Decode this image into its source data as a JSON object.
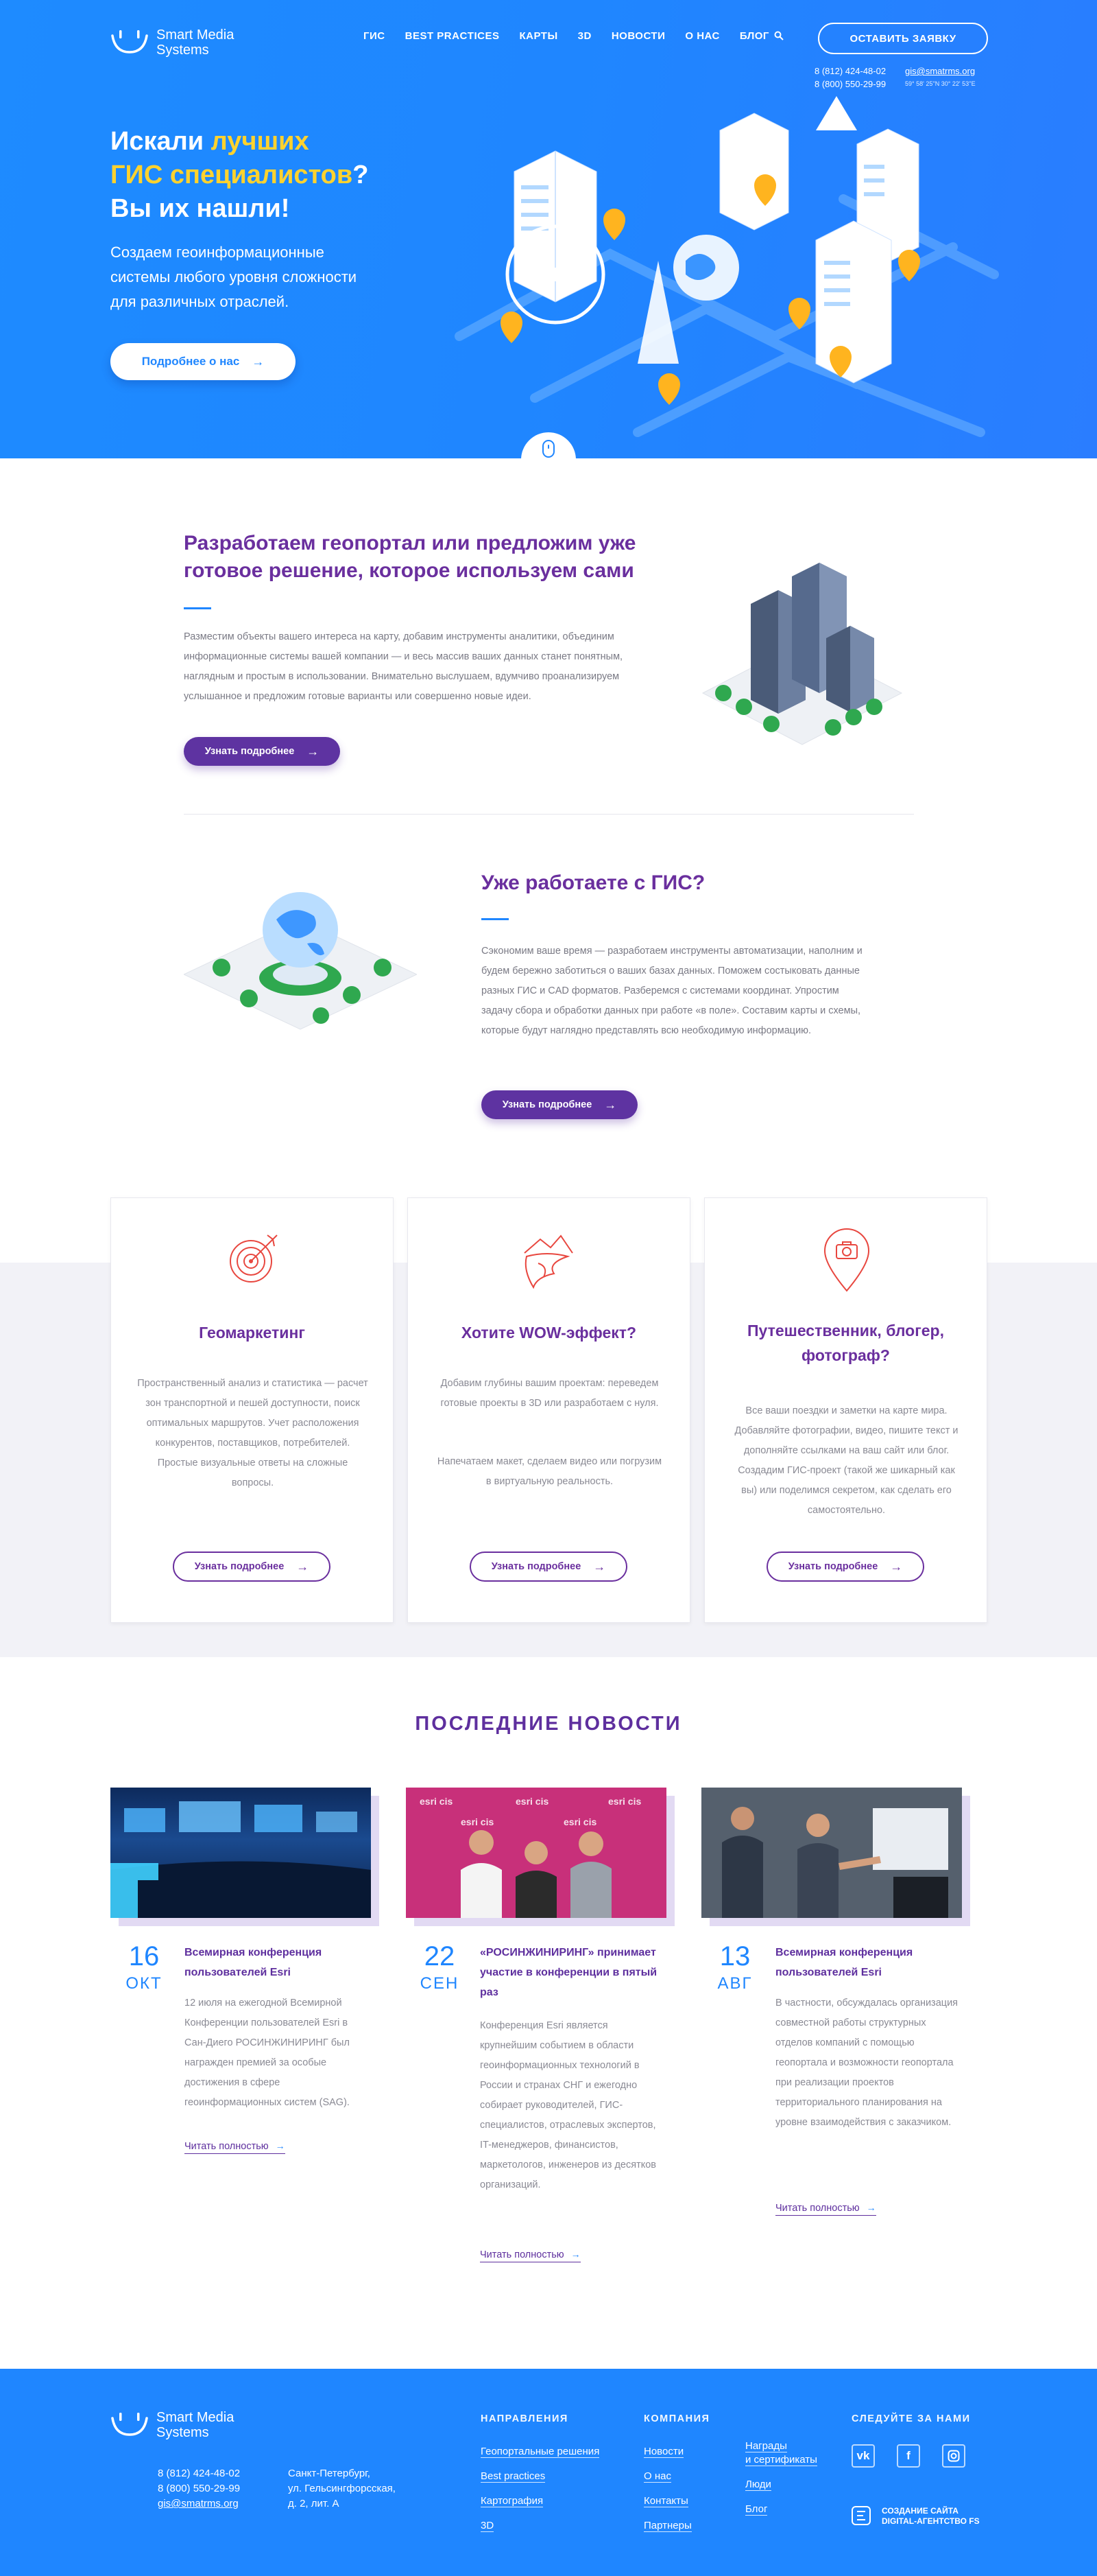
{
  "brand": {
    "line1": "Smart Media",
    "line2": "Systems"
  },
  "nav": {
    "items": [
      "ГИС",
      "BEST PRACTICES",
      "КАРТЫ",
      "3D",
      "НОВОСТИ",
      "О НАС",
      "БЛОГ"
    ]
  },
  "header": {
    "cta_label": "ОСТАВИТЬ ЗАЯВКУ",
    "phone1": "8 (812) 424-48-02",
    "phone2": "8 (800) 550-29-99",
    "email": "gis@smatrms.org",
    "coords": "59° 58' 25''N  30° 22' 53''E"
  },
  "hero": {
    "title_a": "Искали ",
    "title_b": "лучших",
    "title_c": "ГИС специалистов",
    "title_d": "?",
    "title_e": "Вы их нашли!",
    "lead": "Создаем геоинформационные системы любого уровня сложности для различных отраслей.",
    "button": "Подробнее о нас"
  },
  "block1": {
    "title": "Разработаем геопортал или предложим уже готовое решение, которое используем сами",
    "text": "Разместим объекты вашего интереса на карту, добавим инструменты аналитики, объединим информационные системы вашей компании — и весь массив ваших данных станет понятным, наглядным и простым в использовании. Внимательно выслушаем, вдумчиво проанализируем услышанное и предложим готовые варианты или совершенно новые идеи.",
    "button": "Узнать подробнее"
  },
  "block2": {
    "title": "Уже работаете с ГИС?",
    "text": "Сэкономим ваше время — разработаем инструменты автоматизации, наполним и будем бережно заботиться о ваших базах данных. Поможем состыковать данные разных ГИС и CAD форматов. Разберемся с системами координат. Упростим задачу сбора и обработки данных при работе «в поле». Составим карты и схемы, которые будут наглядно представлять всю необходимую информацию.",
    "button": "Узнать подробнее"
  },
  "cards": [
    {
      "title": "Геомаркетинг",
      "text": "Пространственный анализ и статистика — расчет зон транспортной и пешей доступности, поиск оптимальных маршрутов. Учет расположения конкурентов, поставщиков, потребителей. Простые визуальные ответы на сложные вопросы.",
      "button": "Узнать подробнее",
      "icon": "target-icon"
    },
    {
      "title": "Хотите WOW-эффект?",
      "text": "Добавим глубины вашим проектам: переведем готовые проекты в 3D или разработаем с нуля.",
      "text2": "Напечатаем макет, сделаем видео или погрузим в виртуальную реальность.",
      "button": "Узнать подробнее",
      "icon": "landscape-icon"
    },
    {
      "title": "Путешественник, блогер, фотограф?",
      "text": "Все ваши поездки и заметки на карте мира. Добавляйте фотографии, видео, пишите текст и дополняйте ссылками на ваш сайт или блог. Создадим ГИС-проект (такой же шикарный как вы) или поделимся секретом, как сделать его самостоятельно.",
      "button": "Узнать подробнее",
      "icon": "camera-pin-icon"
    }
  ],
  "news": {
    "title": "ПОСЛЕДНИЕ НОВОСТИ",
    "items": [
      {
        "day": "16",
        "month": "ОКТ",
        "headline": "Всемирная конференция пользователей Esri",
        "text": "12 июля на ежегодной Всемирной Конференции пользователей Esri в Сан-Диего РОСИНЖИНИРИНГ был награжден премией за особые достижения в сфере геоинформационных систем (SAG).",
        "more": "Читать полностью"
      },
      {
        "day": "22",
        "month": "СЕН",
        "headline": "«РОСИНЖИНИРИНГ» принимает участие в конференции в пятый раз",
        "text": "Конференция Esri является крупнейшим событием в области геоинформационных технологий в России и странах СНГ и ежегодно собирает руководителей, ГИС-специалистов, отраслевых экспертов, IT-менеджеров, финансистов, маркетологов, инженеров из десятков организаций.",
        "more": "Читать полностью",
        "banner": "esri cis"
      },
      {
        "day": "13",
        "month": "АВГ",
        "headline": "Всемирная конференция пользователей Esri",
        "text": "В частности, обсуждалась организация совместной работы структурных отделов компаний с помощью геопортала и возможности геопортала при реализации проектов территориального планирования на уровне взаимодействия с заказчиком.",
        "more": "Читать полностью"
      }
    ]
  },
  "footer": {
    "phone1": "8 (812) 424-48-02",
    "phone2": "8 (800) 550-29-99",
    "email": "gis@smatrms.org",
    "addr1": "Санкт-Петербург,",
    "addr2": "ул. Гельсингфорсская,",
    "addr3": "д. 2, лит. А",
    "col1_title": "НАПРАВЛЕНИЯ",
    "col1": [
      "Геопортальные решения",
      "Best practices",
      "Картография",
      "3D"
    ],
    "col2_title": "КОМПАНИЯ",
    "col2": [
      "Новости",
      "О нас",
      "Контакты",
      "Партнеры"
    ],
    "col3": [
      "Награды",
      "и сертификаты",
      "Люди",
      "Блог"
    ],
    "social_title": "СЛЕДУЙТЕ ЗА НАМИ",
    "social": [
      "vk-icon",
      "facebook-icon",
      "instagram-icon"
    ],
    "credit1": "СОЗДАНИЕ САЙТА",
    "credit2": "DIGITAL-АГЕНТСТВО FS"
  }
}
